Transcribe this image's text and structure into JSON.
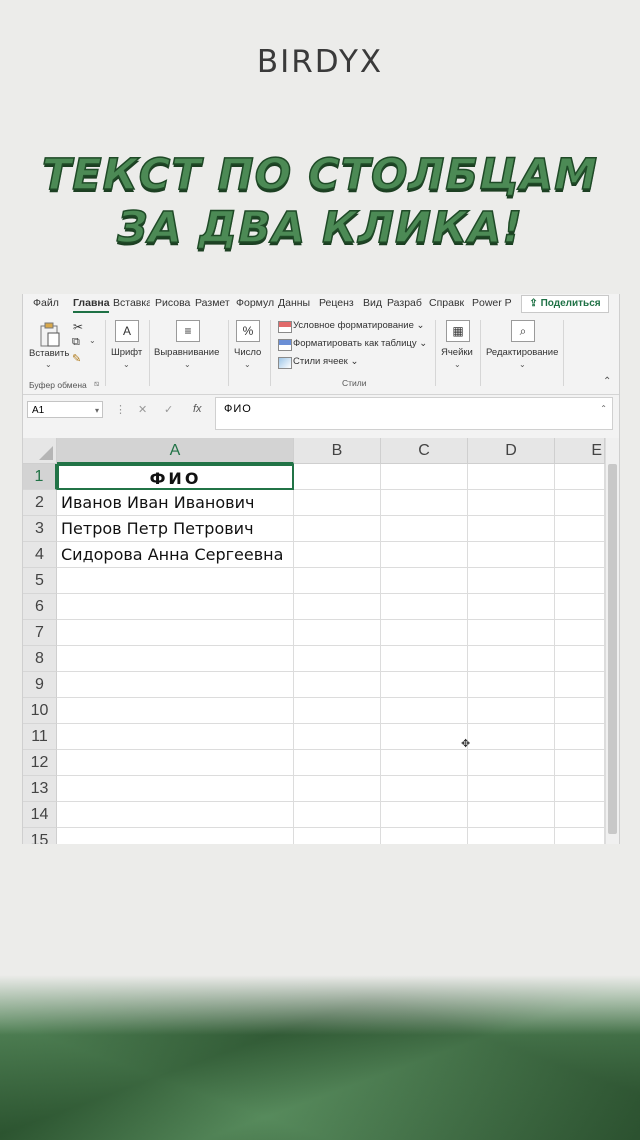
{
  "brand": "BIRDYX",
  "headline": {
    "line1": "ТЕКСТ ПО СТОЛБЦАМ",
    "line2": "ЗА ДВА КЛИКА!"
  },
  "excel": {
    "tabs": [
      "Файл",
      "Главна",
      "Вставка",
      "Рисова",
      "Размет",
      "Формул",
      "Данны",
      "Реценз",
      "Вид",
      "Разраб",
      "Справк",
      "Power P"
    ],
    "active_tab": "Главна",
    "share_label": "Поделиться",
    "ribbon": {
      "paste": "Вставить",
      "clipboard_group": "Буфер обмена",
      "font": "Шрифт",
      "alignment": "Выравнивание",
      "number": "Число",
      "conditional_formatting": "Условное форматирование",
      "format_as_table": "Форматировать как таблицу",
      "cell_styles": "Стили ячеек",
      "styles_group": "Стили",
      "cells": "Ячейки",
      "editing": "Редактирование"
    },
    "name_box": "A1",
    "formula_content": "ФИО",
    "columns": [
      "A",
      "B",
      "C",
      "D",
      "E"
    ],
    "rows": [
      "1",
      "2",
      "3",
      "4",
      "5",
      "6",
      "7",
      "8",
      "9",
      "10",
      "11",
      "12",
      "13",
      "14",
      "15"
    ],
    "cells": {
      "A1": "ФИО",
      "A2": "Иванов Иван Иванович",
      "A3": "Петров Петр Петрович",
      "A4": "Сидорова Анна Сергеевна"
    },
    "active_cell": "A1"
  },
  "colors": {
    "headline_green": "#4c8a55",
    "excel_green": "#217346"
  }
}
